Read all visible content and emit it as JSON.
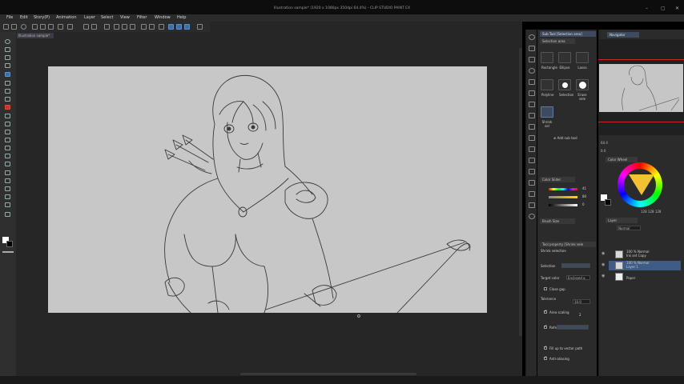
{
  "window": {
    "title": "Illustration sample* (1920 x 1080px 350dpi 64.4%) - CLIP STUDIO PAINT EX",
    "controls": [
      "–",
      "▢",
      "✕"
    ]
  },
  "menu": [
    "File",
    "Edit",
    "Story(P)",
    "Animation",
    "Layer",
    "Select",
    "View",
    "Filter",
    "Window",
    "Help"
  ],
  "document_tab": "Illustration sample*",
  "sub_tool_panel": {
    "tabs": [
      "Sub Tool [Selection area]",
      "Selection area"
    ],
    "tools": [
      {
        "label": "Rectangle",
        "icon": "rectangle-select-icon"
      },
      {
        "label": "Ellipse",
        "icon": "ellipse-select-icon"
      },
      {
        "label": "Lasso",
        "icon": "lasso-icon"
      },
      {
        "label": "Polyline",
        "icon": "polyline-icon"
      },
      {
        "label": "Selection",
        "icon": "selection-pen-icon"
      },
      {
        "label": "Erase sele",
        "icon": "erase-selection-icon"
      },
      {
        "label": "Shrink sel",
        "icon": "shrink-selection-icon"
      }
    ],
    "add_sub_tool": "Add sub tool"
  },
  "tool_property": {
    "header": "Tool property [Shrink sele",
    "tool_name": "Shrink selection",
    "rows": {
      "selection": "Selection",
      "target_color": "Target color",
      "target_color_value": "Enclosed a",
      "close_gap": "Close gap",
      "tolerance": "Tolerance",
      "tolerance_value": "10.0",
      "area_scaling": "Area scaling",
      "area_scaling_value": "2",
      "refer": "Refe",
      "fill_vector": "Fill up to vector path",
      "anti_aliasing": "Anti-aliasing"
    }
  },
  "color_slider": {
    "header": "Color Slider",
    "values": [
      "41",
      "80",
      "0"
    ]
  },
  "brush_size": {
    "header": "Brush Size"
  },
  "navigator": {
    "tab": "Navigator",
    "zoom": "64.4",
    "rotation": "0.0"
  },
  "color_wheel": {
    "tab": "Color Wheel",
    "readout": "128  128  128"
  },
  "layers": {
    "tab": "Layer",
    "blend_mode": "Normal",
    "rows": [
      {
        "line1": "100 % Normal",
        "line2": "Ink set Copy",
        "selected": false
      },
      {
        "line1": "100 % Normal",
        "line2": "Layer 1",
        "selected": true
      },
      {
        "line1": "",
        "line2": "Paper",
        "selected": false
      }
    ]
  },
  "colors": {
    "accent": "#3e5c86",
    "canvas_paper": "#c7c7c7",
    "panel_bg": "#2b2b2b",
    "main_color": "#ffffff",
    "sub_color": "#000000"
  }
}
